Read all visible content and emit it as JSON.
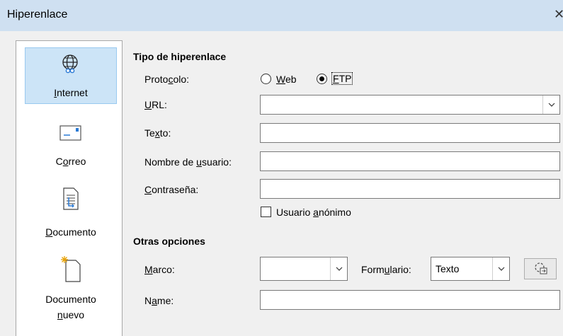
{
  "window": {
    "title": "Hiperenlace",
    "close_glyph": "✕"
  },
  "sidebar": {
    "items": [
      {
        "label": "Internet",
        "icon": "globe-icon",
        "selected": true
      },
      {
        "label": "Correo",
        "icon": "mail-icon"
      },
      {
        "label": "Documento",
        "icon": "document-icon"
      },
      {
        "label_line1": "Documento",
        "label_line2": "nuevo",
        "icon": "new-document-icon"
      }
    ]
  },
  "hyperlink_type": {
    "section_title": "Tipo de hiperenlace",
    "protocol_label": "Protocolo:",
    "protocol_options": [
      "Web",
      "FTP"
    ],
    "protocol_selected": "FTP",
    "url_label": "URL:",
    "url_value": "",
    "text_label": "Texto:",
    "text_value": "",
    "username_label": "Nombre de usuario:",
    "username_value": "",
    "password_label": "Contraseña:",
    "password_value": "",
    "anonymous_label": "Usuario anónimo",
    "anonymous_checked": false
  },
  "other_options": {
    "section_title": "Otras opciones",
    "frame_label": "Marco:",
    "frame_value": "",
    "form_label": "Formulario:",
    "form_value": "Texto",
    "name_label": "Name:",
    "name_value": ""
  },
  "colors": {
    "titlebar": "#cfe0f1",
    "selected_item": "#cce4f7",
    "background": "#f0f0f0"
  }
}
